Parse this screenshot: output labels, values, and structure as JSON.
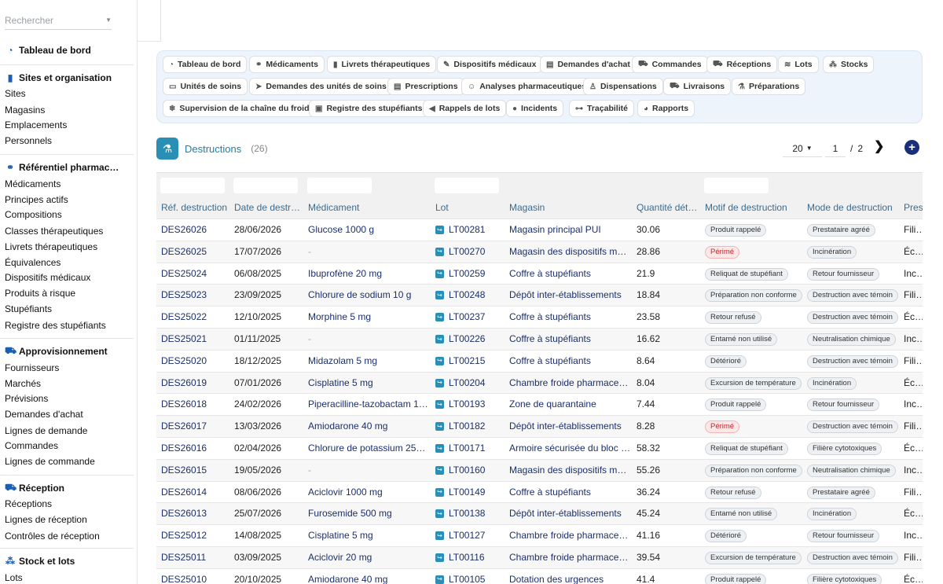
{
  "sidebar": {
    "search_placeholder": "Rechercher",
    "dashboard": {
      "label": "Tableau de bord",
      "icon": "dashboard-icon"
    },
    "sections": [
      {
        "title": "Sites et organisation",
        "icon": "building-icon",
        "items": [
          "Sites",
          "Magasins",
          "Emplacements",
          "Personnels"
        ]
      },
      {
        "title": "Référentiel pharmac…",
        "icon": "pills-icon",
        "items": [
          "Médicaments",
          "Principes actifs",
          "Compositions",
          "Classes thérapeutiques",
          "Livrets thérapeutiques",
          "Équivalences",
          "Dispositifs médicaux",
          "Produits à risque",
          "Stupéfiants",
          "Registre des stupéfiants"
        ]
      },
      {
        "title": "Approvisionnement",
        "icon": "cart-icon",
        "items": [
          "Fournisseurs",
          "Marchés",
          "Prévisions",
          "Demandes d'achat",
          "Lignes de demande",
          "Commandes",
          "Lignes de commande"
        ]
      },
      {
        "title": "Réception",
        "icon": "truck-loading-icon",
        "items": [
          "Réceptions",
          "Lignes de réception",
          "Contrôles de réception"
        ]
      },
      {
        "title": "Stock et lots",
        "icon": "boxes-icon",
        "items": [
          "Lots"
        ]
      }
    ]
  },
  "nav_pills": [
    {
      "label": "Tableau de bord",
      "icon": "dashboard-icon",
      "glyph": "◔"
    },
    {
      "label": "Médicaments",
      "icon": "pills-icon",
      "glyph": "⚭"
    },
    {
      "label": "Livrets thérapeutiques",
      "icon": "book-icon",
      "glyph": "▮"
    },
    {
      "label": "Dispositifs médicaux",
      "icon": "syringe-icon",
      "glyph": "✎"
    },
    {
      "label": "Demandes d'achat",
      "icon": "file-icon",
      "glyph": "▤"
    },
    {
      "label": "Commandes",
      "icon": "cart-icon",
      "glyph": "⛟"
    },
    {
      "label": "Réceptions",
      "icon": "truck-loading-icon",
      "glyph": "⛟"
    },
    {
      "label": "Lots",
      "icon": "layers-icon",
      "glyph": "≋"
    },
    {
      "label": "Stocks",
      "icon": "cubes-icon",
      "glyph": "⁂"
    },
    {
      "label": "Unités de soins",
      "icon": "bed-icon",
      "glyph": "▭"
    },
    {
      "label": "Demandes des unités de soins",
      "icon": "paper-plane-icon",
      "glyph": "➤"
    },
    {
      "label": "Prescriptions",
      "icon": "prescription-icon",
      "glyph": "▤"
    },
    {
      "label": "Analyses pharmaceutiques",
      "icon": "user-check-icon",
      "glyph": "☺"
    },
    {
      "label": "Dispensations",
      "icon": "hand-pill-icon",
      "glyph": "♙"
    },
    {
      "label": "Livraisons",
      "icon": "shipping-icon",
      "glyph": "⛟"
    },
    {
      "label": "Préparations",
      "icon": "mortar-icon",
      "glyph": "⚗"
    },
    {
      "label": "Supervision de la chaîne du froid",
      "icon": "snowflake-icon",
      "glyph": "❄"
    },
    {
      "label": "Registre des stupéfiants",
      "icon": "lock-icon",
      "glyph": "▣"
    },
    {
      "label": "Rappels de lots",
      "icon": "bullhorn-icon",
      "glyph": "◀"
    },
    {
      "label": "Incidents",
      "icon": "exclamation-icon",
      "glyph": "●"
    },
    {
      "label": "Traçabilité",
      "icon": "sitemap-icon",
      "glyph": "⊶"
    },
    {
      "label": "Rapports",
      "icon": "chart-pie-icon",
      "glyph": "◕"
    }
  ],
  "page": {
    "title": "Destructions",
    "count": "(26)",
    "page_size": "20",
    "current_page": "1",
    "page_separator": "/",
    "total_pages": "2",
    "next_icon": "chevron-right-icon",
    "add_icon": "plus-circle-icon"
  },
  "table": {
    "columns": [
      "Réf. destruction",
      "Date de destr…",
      "Médicament",
      "Lot",
      "Magasin",
      "Quantité détr…",
      "Motif de destruction",
      "Mode de destruction",
      "Prest"
    ],
    "rows": [
      {
        "ref": "DES26026",
        "date": "28/06/2026",
        "med": "Glucose 1000 g",
        "lot": "LT00281",
        "store": "Magasin principal PUI",
        "qty": "30.06",
        "motif": "Produit rappelé",
        "motif_red": false,
        "mode": "Prestataire agréé",
        "prest": "Filière"
      },
      {
        "ref": "DES26025",
        "date": "17/07/2026",
        "med": "-",
        "lot": "LT00270",
        "store": "Magasin des dispositifs méd…",
        "qty": "28.86",
        "motif": "Périmé",
        "motif_red": true,
        "mode": "Incinération",
        "prest": "Éco-S"
      },
      {
        "ref": "DES25024",
        "date": "06/08/2025",
        "med": "Ibuprofène 20 mg",
        "lot": "LT00259",
        "store": "Coffre à stupéfiants",
        "qty": "21.9",
        "motif": "Reliquat de stupéfiant",
        "motif_red": false,
        "mode": "Retour fournisseur",
        "prest": "Incine"
      },
      {
        "ref": "DES25023",
        "date": "23/09/2025",
        "med": "Chlorure de sodium 10 g",
        "lot": "LT00248",
        "store": "Dépôt inter-établissements",
        "qty": "18.84",
        "motif": "Préparation non conforme",
        "motif_red": false,
        "mode": "Destruction avec témoin",
        "prest": "Filière"
      },
      {
        "ref": "DES25022",
        "date": "12/10/2025",
        "med": "Morphine 5 mg",
        "lot": "LT00237",
        "store": "Coffre à stupéfiants",
        "qty": "23.58",
        "motif": "Retour refusé",
        "motif_red": false,
        "mode": "Destruction avec témoin",
        "prest": "Éco-S"
      },
      {
        "ref": "DES25021",
        "date": "01/11/2025",
        "med": "-",
        "lot": "LT00226",
        "store": "Coffre à stupéfiants",
        "qty": "16.62",
        "motif": "Entamé non utilisé",
        "motif_red": false,
        "mode": "Neutralisation chimique",
        "prest": "Incine"
      },
      {
        "ref": "DES25020",
        "date": "18/12/2025",
        "med": "Midazolam 5 mg",
        "lot": "LT00215",
        "store": "Coffre à stupéfiants",
        "qty": "8.64",
        "motif": "Détérioré",
        "motif_red": false,
        "mode": "Destruction avec témoin",
        "prest": "Filière"
      },
      {
        "ref": "DES26019",
        "date": "07/01/2026",
        "med": "Cisplatine 5 mg",
        "lot": "LT00204",
        "store": "Chambre froide pharmaceut…",
        "qty": "8.04",
        "motif": "Excursion de température",
        "motif_red": false,
        "mode": "Incinération",
        "prest": "Éco-S"
      },
      {
        "ref": "DES26018",
        "date": "24/02/2026",
        "med": "Piperacilline-tazobactam 10 …",
        "lot": "LT00193",
        "store": "Zone de quarantaine",
        "qty": "7.44",
        "motif": "Produit rappelé",
        "motif_red": false,
        "mode": "Retour fournisseur",
        "prest": "Incine"
      },
      {
        "ref": "DES26017",
        "date": "13/03/2026",
        "med": "Amiodarone 40 mg",
        "lot": "LT00182",
        "store": "Dépôt inter-établissements",
        "qty": "8.28",
        "motif": "Périmé",
        "motif_red": true,
        "mode": "Destruction avec témoin",
        "prest": "Filière"
      },
      {
        "ref": "DES26016",
        "date": "02/04/2026",
        "med": "Chlorure de potassium 250 …",
        "lot": "LT00171",
        "store": "Armoire sécurisée du bloc o…",
        "qty": "58.32",
        "motif": "Reliquat de stupéfiant",
        "motif_red": false,
        "mode": "Filière cytotoxiques",
        "prest": "Éco-S"
      },
      {
        "ref": "DES26015",
        "date": "19/05/2026",
        "med": "-",
        "lot": "LT00160",
        "store": "Magasin des dispositifs méd…",
        "qty": "55.26",
        "motif": "Préparation non conforme",
        "motif_red": false,
        "mode": "Neutralisation chimique",
        "prest": "Incine"
      },
      {
        "ref": "DES26014",
        "date": "08/06/2026",
        "med": "Aciclovir 1000 mg",
        "lot": "LT00149",
        "store": "Coffre à stupéfiants",
        "qty": "36.24",
        "motif": "Retour refusé",
        "motif_red": false,
        "mode": "Prestataire agréé",
        "prest": "Filière"
      },
      {
        "ref": "DES26013",
        "date": "25/07/2026",
        "med": "Furosemide 500 mg",
        "lot": "LT00138",
        "store": "Dépôt inter-établissements",
        "qty": "45.24",
        "motif": "Entamé non utilisé",
        "motif_red": false,
        "mode": "Incinération",
        "prest": "Éco-S"
      },
      {
        "ref": "DES25012",
        "date": "14/08/2025",
        "med": "Cisplatine 5 mg",
        "lot": "LT00127",
        "store": "Chambre froide pharmaceut…",
        "qty": "41.16",
        "motif": "Détérioré",
        "motif_red": false,
        "mode": "Retour fournisseur",
        "prest": "Incine"
      },
      {
        "ref": "DES25011",
        "date": "03/09/2025",
        "med": "Aciclovir 20 mg",
        "lot": "LT00116",
        "store": "Chambre froide pharmaceut…",
        "qty": "39.54",
        "motif": "Excursion de température",
        "motif_red": false,
        "mode": "Destruction avec témoin",
        "prest": "Filière"
      },
      {
        "ref": "DES25010",
        "date": "20/10/2025",
        "med": "Amiodarone 40 mg",
        "lot": "LT00105",
        "store": "Dotation des urgences",
        "qty": "41.4",
        "motif": "Produit rappelé",
        "motif_red": false,
        "mode": "Filière cytotoxiques",
        "prest": "Éco-S"
      }
    ]
  }
}
